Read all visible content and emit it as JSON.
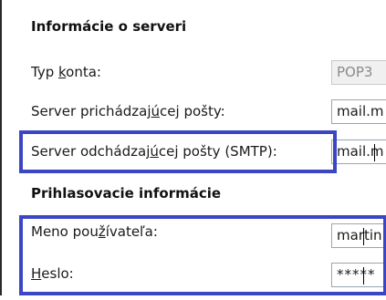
{
  "sections": {
    "server_info_title": "Informácie o serveri",
    "login_info_title": "Prihlasovacie informácie"
  },
  "fields": {
    "account_type": {
      "label_before": "Typ ",
      "label_accel": "k",
      "label_after": "onta:",
      "value": "POP3"
    },
    "incoming_server": {
      "label_before": "Server prichádzaj",
      "label_accel": "ú",
      "label_after": "cej pošty:",
      "value": "mail.m"
    },
    "outgoing_server": {
      "label_before": "Server odchádzaj",
      "label_accel": "ú",
      "label_after": "cej pošty (SMTP):",
      "value": "mail.m"
    },
    "username": {
      "label_before": "Meno pou",
      "label_accel": "ž",
      "label_after": "ívateľa:",
      "value": "martin"
    },
    "password": {
      "label_before": "",
      "label_accel": "H",
      "label_after": "eslo:",
      "value": "*****"
    }
  },
  "colors": {
    "highlight_border": "#3a46c4",
    "field_border": "#9aa5b1",
    "readonly_background": "#f0f0f0"
  }
}
